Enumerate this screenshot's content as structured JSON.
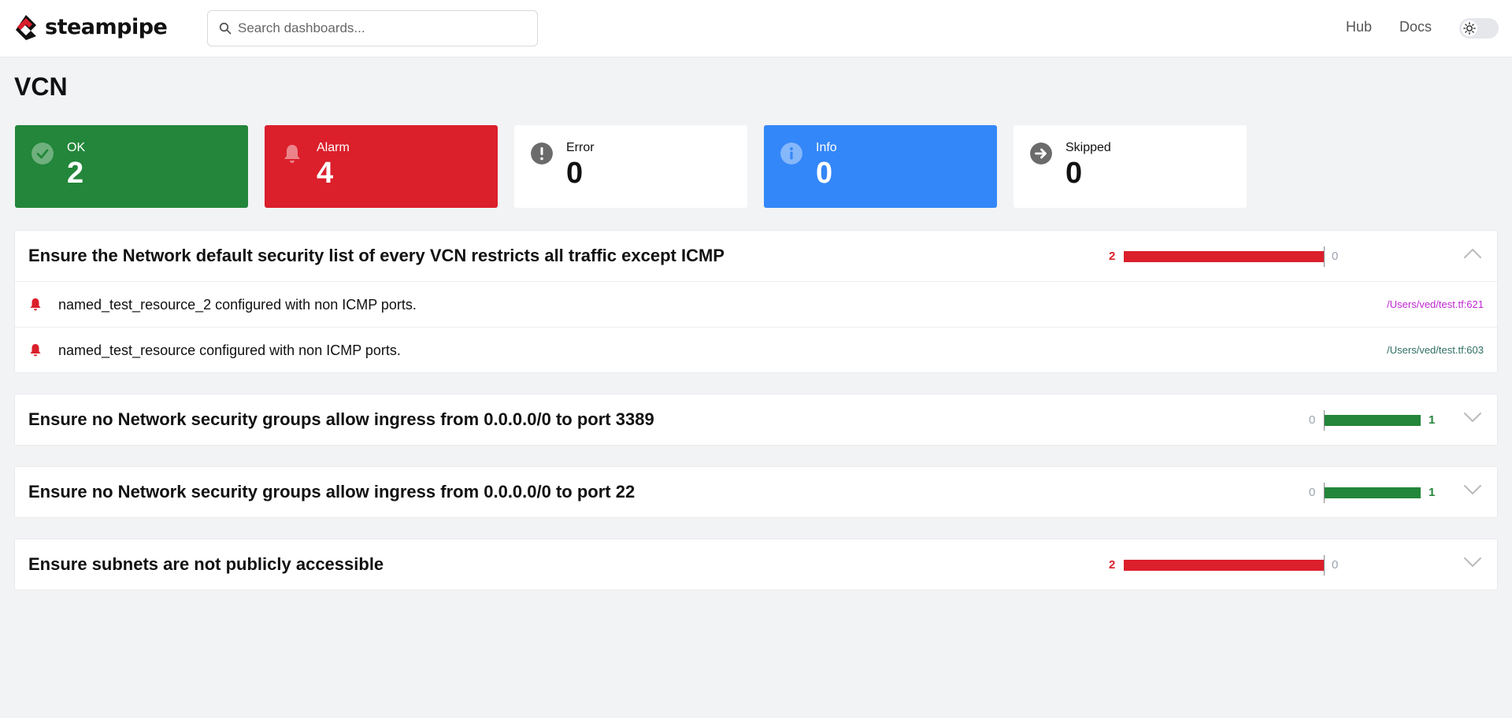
{
  "app": {
    "logo_text": "steampipe"
  },
  "search": {
    "placeholder": "Search dashboards..."
  },
  "nav": {
    "hub": "Hub",
    "docs": "Docs"
  },
  "page": {
    "title": "VCN"
  },
  "summary": [
    {
      "label": "OK",
      "value": "2",
      "color": "#23863a"
    },
    {
      "label": "Alarm",
      "value": "4",
      "color": "#db1f2b"
    },
    {
      "label": "Error",
      "value": "0",
      "color": "#ffffff"
    },
    {
      "label": "Info",
      "value": "0",
      "color": "#3487f8"
    },
    {
      "label": "Skipped",
      "value": "0",
      "color": "#ffffff"
    }
  ],
  "controls": [
    {
      "title": "Ensure the Network default security list of every VCN restricts all traffic except ICMP",
      "alarm_count": "2",
      "ok_count": "0",
      "expanded": true,
      "results": [
        {
          "status": "alarm",
          "text": "named_test_resource_2 configured with non ICMP ports.",
          "path": "/Users/ved/test.tf:621",
          "path_color": "#c026d3"
        },
        {
          "status": "alarm",
          "text": "named_test_resource configured with non ICMP ports.",
          "path": "/Users/ved/test.tf:603",
          "path_color": "#2f6f63"
        }
      ]
    },
    {
      "title": "Ensure no Network security groups allow ingress from 0.0.0.0/0 to port 3389",
      "alarm_count": "0",
      "ok_count": "1",
      "expanded": false
    },
    {
      "title": "Ensure no Network security groups allow ingress from 0.0.0.0/0 to port 22",
      "alarm_count": "0",
      "ok_count": "1",
      "expanded": false
    },
    {
      "title": "Ensure subnets are not publicly accessible",
      "alarm_count": "2",
      "ok_count": "0",
      "expanded": false
    }
  ],
  "colors": {
    "alarm": "#db1f2b",
    "ok": "#23863a",
    "muted": "#9ca3af"
  }
}
